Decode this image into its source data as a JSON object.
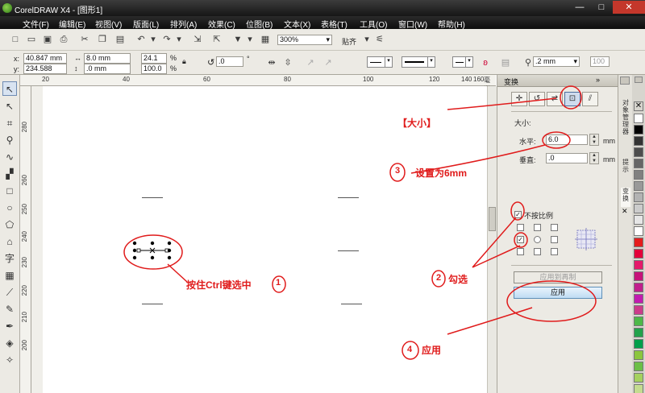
{
  "window": {
    "title": "CorelDRAW X4 - [图形1]",
    "controls": [
      "—",
      "□",
      "✕"
    ]
  },
  "menu": [
    "文件(F)",
    "编辑(E)",
    "视图(V)",
    "版面(L)",
    "排列(A)",
    "效果(C)",
    "位图(B)",
    "文本(X)",
    "表格(T)",
    "工具(O)",
    "窗口(W)",
    "帮助(H)"
  ],
  "toolbar": {
    "zoom": "300%",
    "snap_label": "贴齐"
  },
  "property_bar": {
    "x_label": "x:",
    "x": "40.847 mm",
    "y_label": "y:",
    "y": "234.588 mm",
    "width": "8.0 mm",
    "height": ".0 mm",
    "scale_x": "24.1",
    "scale_y": "100.0",
    "percent": "%",
    "rotation": ".0",
    "degree": "°",
    "outline_width": ".2 mm",
    "outline_value": "100"
  },
  "ruler": {
    "h_ticks": [
      "20",
      "40",
      "60",
      "80",
      "100",
      "120",
      "140",
      "160"
    ],
    "v_ticks": [
      "280",
      "260",
      "250",
      "240",
      "230",
      "220",
      "210",
      "200"
    ],
    "unit": "毫米"
  },
  "docker": {
    "title": "变换",
    "section_size": "大小:",
    "h_label": "水平:",
    "h_value": "6.0",
    "v_label": "垂直:",
    "v_value": ".0",
    "unit": "mm",
    "proportional_label": "不按比例",
    "apply_to_duplicate": "应用到再制",
    "apply": "应用",
    "side_tabs": [
      "对象管理器",
      "提示",
      "变换"
    ]
  },
  "annotations": {
    "size_tab": "【大小】",
    "step1": "按住Ctrl键选中",
    "step1_num": "1",
    "step2": "勾选",
    "step2_num": "2",
    "step3": "设置为6mm",
    "step3_num": "3",
    "step4": "应用",
    "step4_num": "4"
  },
  "colors": {
    "annotation": "#e01b1b",
    "palette": [
      "#ffffff",
      "#000000",
      "#333333",
      "#4d4d4d",
      "#666666",
      "#808080",
      "#999999",
      "#b3b3b3",
      "#cccccc",
      "#e6e6e6",
      "#ffffff",
      "#e41c1c",
      "#e4003a",
      "#e51a6b",
      "#c6137a",
      "#c11f8d",
      "#c21bb0",
      "#cc3b8b",
      "#4db848",
      "#22a24b",
      "#009f4a",
      "#8cc63f",
      "#6cbf47",
      "#a5d15f",
      "#c4dc90"
    ]
  }
}
